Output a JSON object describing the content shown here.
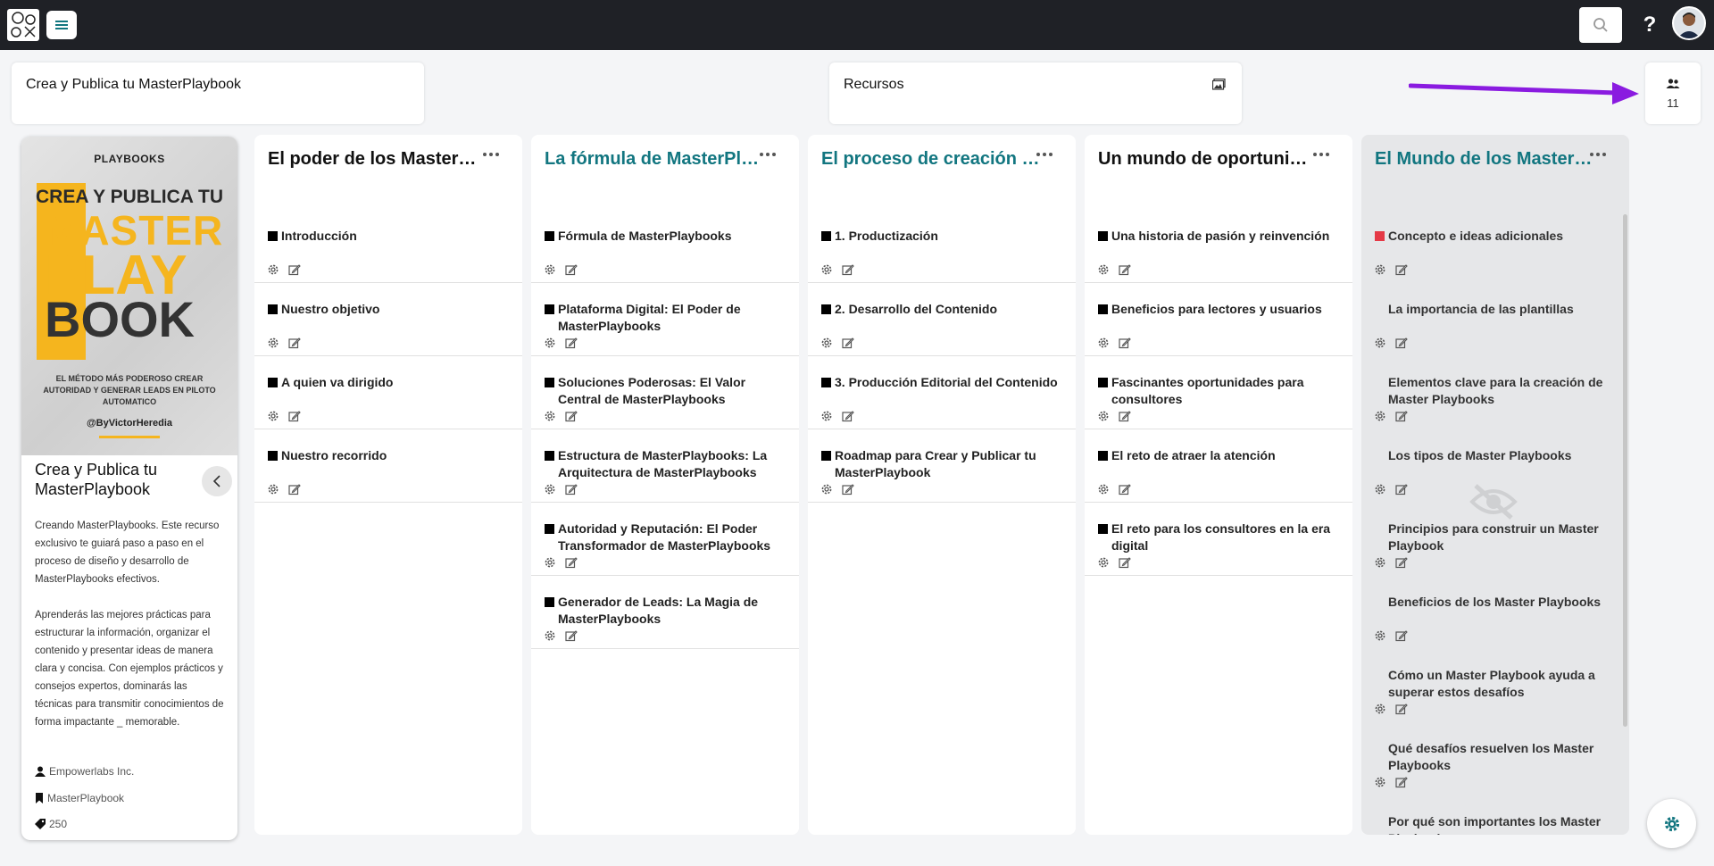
{
  "header": {
    "playbook_title": "Crea y Publica tu MasterPlaybook",
    "resources_title": "Recursos",
    "members_count": "11",
    "help_label": "?"
  },
  "colors": {
    "accent_teal": "#127680",
    "topbar": "#1f2126",
    "arrow": "#8a1be0",
    "cover_yellow": "#f5b51e",
    "marker_red": "#e53946"
  },
  "icons": {
    "logo": "oox-logo-icon",
    "menu": "hamburger-menu-icon",
    "search": "search-icon",
    "resources": "image-gallery-icon",
    "members": "people-icon",
    "item_settings": "gear-icon",
    "item_edit": "edit-icon",
    "collapse": "chevron-left-icon",
    "hidden": "eye-slash-icon",
    "fab": "gear-icon"
  },
  "cover": {
    "image": {
      "brand": "PLAYBOOKS",
      "line1": "CREA Y PUBLICA TU",
      "line2": "MASTER",
      "line3": "PLAY",
      "line4": "BOOK",
      "tagline": "EL MÉTODO MÁS PODEROSO CREAR AUTORIDAD Y GENERAR LEADS EN PILOTO AUTOMATICO",
      "handle": "@ByVictorHeredia"
    },
    "title": "Crea y Publica tu MasterPlaybook",
    "description_1": "Creando MasterPlaybooks. Este recurso exclusivo te guiará paso a paso en el proceso de diseño y desarrollo de MasterPlaybooks efectivos.",
    "description_2": "Aprenderás las mejores prácticas para estructurar la información, organizar el contenido y presentar ideas de manera clara y concisa. Con ejemplos prácticos y consejos expertos, dominarás las técnicas para transmitir conocimientos de forma impactante _ memorable.",
    "author": "Empowerlabs Inc.",
    "category": "MasterPlaybook",
    "tokens": "250"
  },
  "columns": [
    {
      "title": "El poder de los MasterPlaybooks",
      "items": [
        "Introducción",
        "Nuestro objetivo",
        "A quien va dirigido",
        "Nuestro recorrido"
      ]
    },
    {
      "title": "La fórmula de MasterPlaybooks",
      "items": [
        "Fórmula de MasterPlaybooks",
        "Plataforma Digital: El Poder de MasterPlaybooks",
        "Soluciones Poderosas: El Valor Central de MasterPlaybooks",
        "Estructura de MasterPlaybooks: La Arquitectura de MasterPlaybooks",
        "Autoridad y Reputación: El Poder Transformador de MasterPlaybooks",
        "Generador de Leads: La Magia de MasterPlaybooks"
      ]
    },
    {
      "title": "El proceso de creación y publicación",
      "items": [
        "1.  Productización",
        "2. Desarrollo del Contenido",
        "3. Producción Editorial del Contenido",
        "Roadmap para Crear y Publicar tu MasterPlaybook"
      ]
    },
    {
      "title": "Un mundo de oportunidades",
      "items": [
        "Una historia de pasión y reinvención",
        "Beneficios para lectores y usuarios",
        "Fascinantes oportunidades para consultores",
        "El reto de atraer la atención",
        "El reto para los consultores en la era digital"
      ]
    },
    {
      "title": "El Mundo de los Master Playbooks",
      "items": [
        "Concepto e ideas adicionales",
        "La importancia de las plantillas",
        "Elementos clave para la creación de Master Playbooks",
        "Los tipos de Master Playbooks",
        "Principios para construir un Master Playbook",
        "Beneficios de los Master Playbooks",
        "Cómo un Master Playbook ayuda a superar estos desafíos",
        "Qué desafíos resuelven los Master Playbooks",
        "Por qué son importantes los Master Playbooks"
      ]
    }
  ]
}
